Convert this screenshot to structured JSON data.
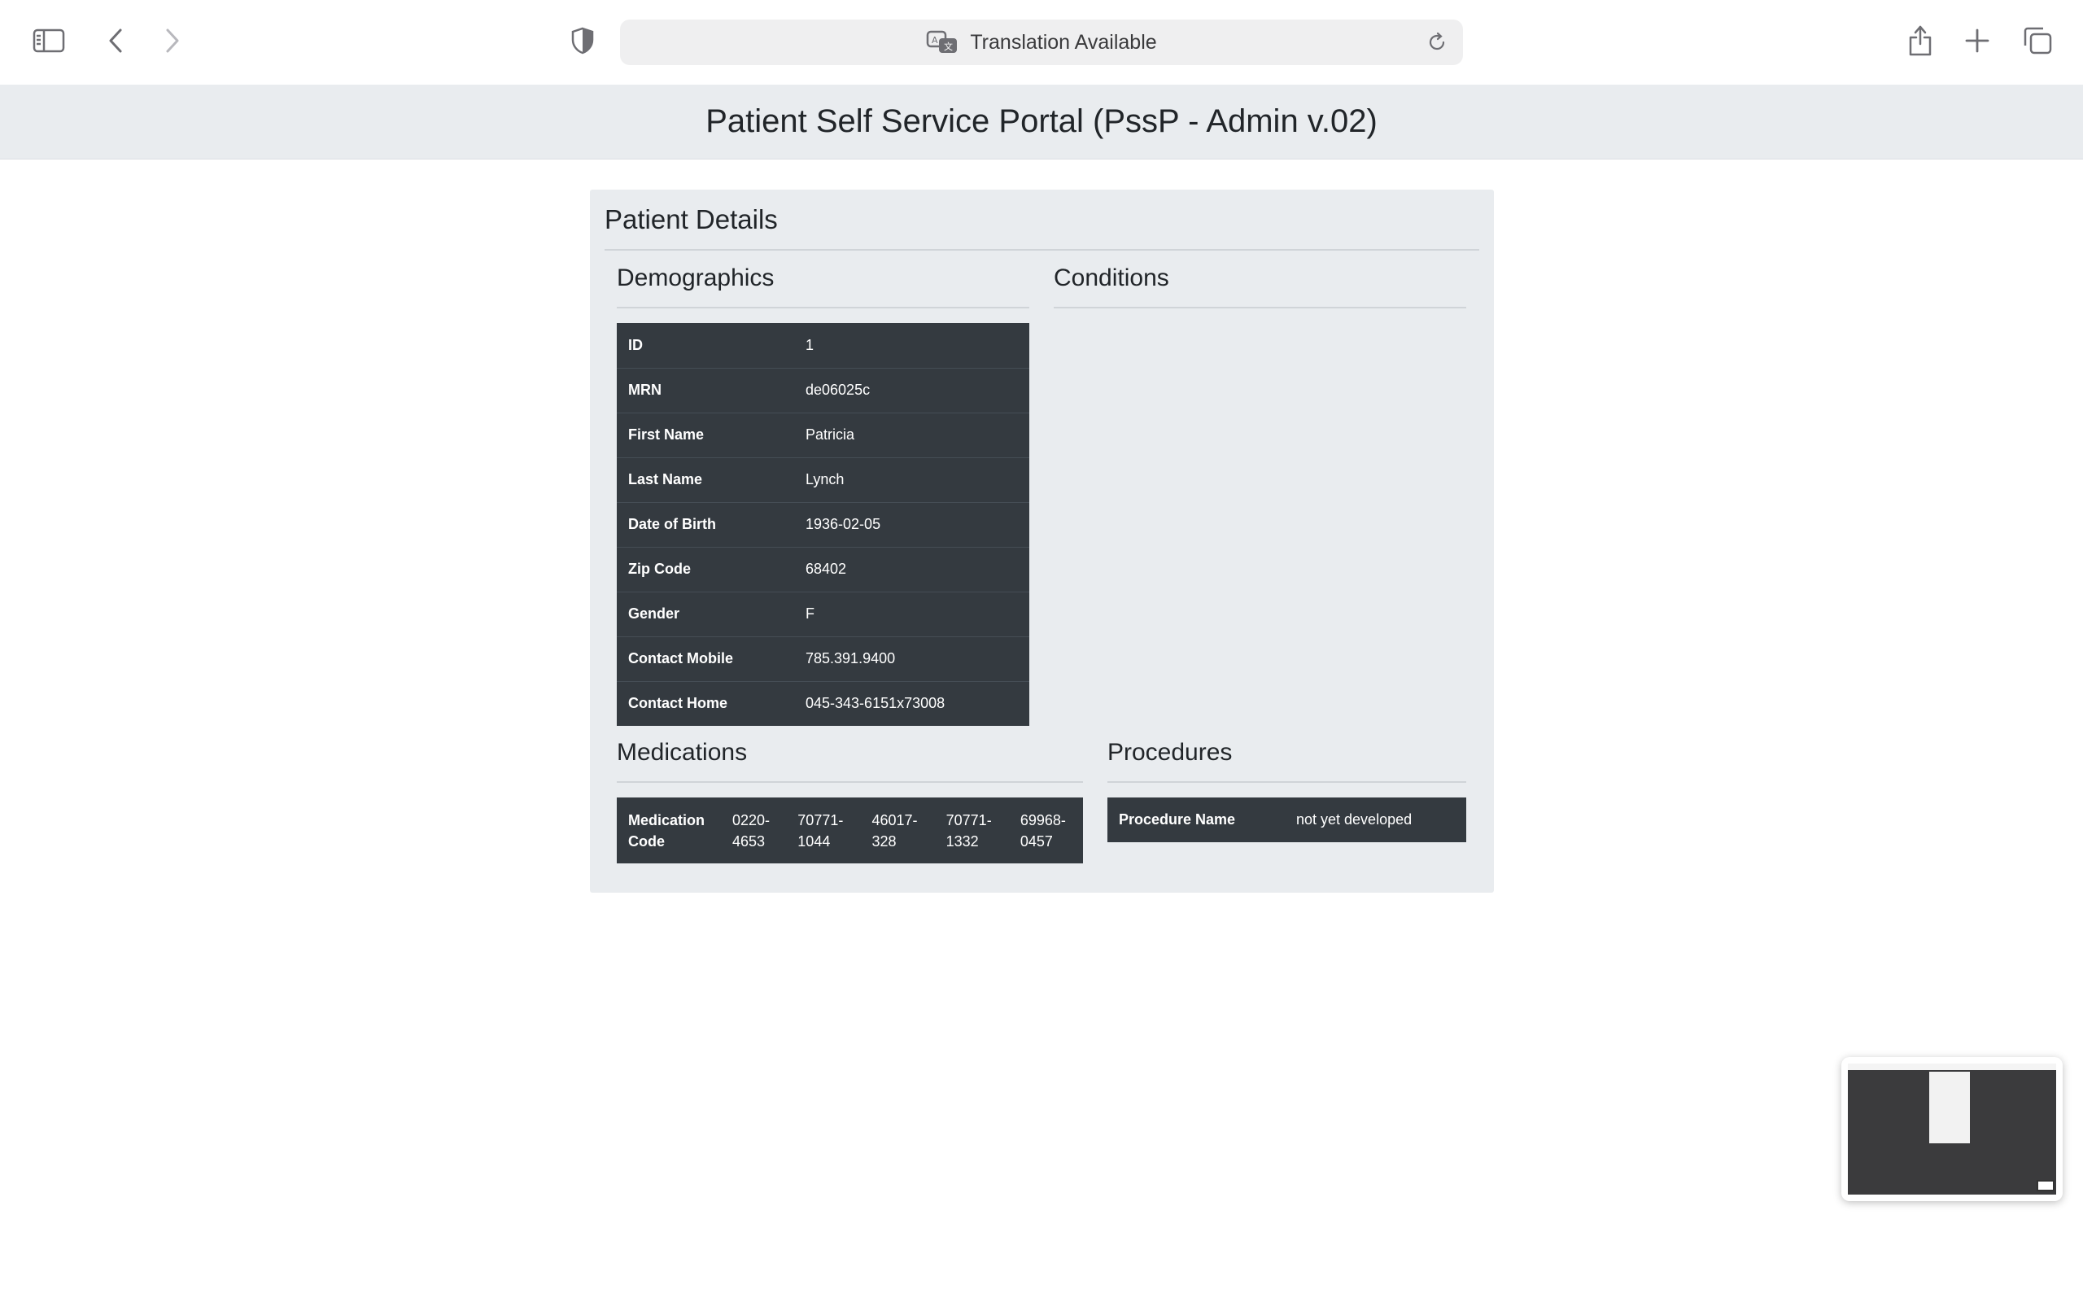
{
  "browser": {
    "address_text": "Translation Available",
    "icons": [
      "sidebar-icon",
      "back-arrow-icon",
      "forward-arrow-icon",
      "shield-icon",
      "translate-icon",
      "reload-icon",
      "share-icon",
      "plus-icon",
      "tabs-icon"
    ]
  },
  "header": {
    "title": "Patient Self Service Portal (PssP - Admin v.02)"
  },
  "card": {
    "title": "Patient Details",
    "demographics": {
      "title": "Demographics",
      "rows": [
        {
          "label": "ID",
          "value": "1"
        },
        {
          "label": "MRN",
          "value": "de06025c"
        },
        {
          "label": "First Name",
          "value": "Patricia"
        },
        {
          "label": "Last Name",
          "value": "Lynch"
        },
        {
          "label": "Date of Birth",
          "value": "1936-02-05"
        },
        {
          "label": "Zip Code",
          "value": "68402"
        },
        {
          "label": "Gender",
          "value": "F"
        },
        {
          "label": "Contact Mobile",
          "value": "785.391.9400"
        },
        {
          "label": "Contact Home",
          "value": "045-343-6151x73008"
        }
      ]
    },
    "conditions": {
      "title": "Conditions"
    },
    "medications": {
      "title": "Medications",
      "label_line1": "Medication",
      "label_line2": "Code",
      "codes": [
        {
          "a": "0220-",
          "b": "4653"
        },
        {
          "a": "70771-",
          "b": "1044"
        },
        {
          "a": "46017-",
          "b": "328"
        },
        {
          "a": "70771-",
          "b": "1332"
        },
        {
          "a": "69968-",
          "b": "0457"
        }
      ]
    },
    "procedures": {
      "title": "Procedures",
      "label": "Procedure Name",
      "value": "not yet developed"
    }
  },
  "colors": {
    "header_bg": "#e9ecef",
    "table_bg": "#343a40"
  }
}
